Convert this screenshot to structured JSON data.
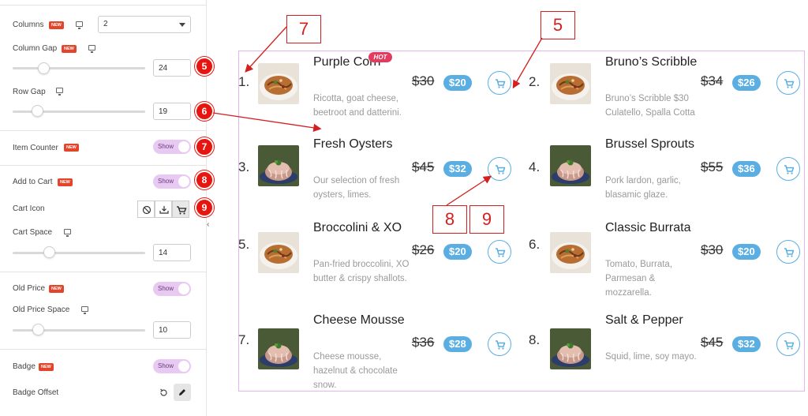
{
  "panel": {
    "new_badge": "NEW",
    "columns": {
      "label": "Columns",
      "value": "2"
    },
    "column_gap": {
      "label": "Column Gap",
      "value": "24",
      "slider_fraction": 0.24
    },
    "row_gap": {
      "label": "Row Gap",
      "value": "19",
      "slider_fraction": 0.19
    },
    "item_counter": {
      "label": "Item Counter",
      "toggle": "Show"
    },
    "add_to_cart": {
      "label": "Add to Cart",
      "toggle": "Show"
    },
    "cart_icon": {
      "label": "Cart Icon",
      "options": [
        "none-icon",
        "download-cart-icon",
        "cart-icon"
      ],
      "selected": "cart-icon"
    },
    "cart_space": {
      "label": "Cart Space",
      "value": "14",
      "slider_fraction": 0.28
    },
    "old_price": {
      "label": "Old Price",
      "toggle": "Show"
    },
    "old_price_space": {
      "label": "Old Price Space",
      "value": "10",
      "slider_fraction": 0.2
    },
    "badge": {
      "label": "Badge",
      "toggle": "Show"
    },
    "badge_offset": {
      "label": "Badge Offset"
    },
    "markers": [
      "5",
      "6",
      "7",
      "8",
      "9"
    ],
    "collapse_glyph": "‹"
  },
  "menu": {
    "hot_badge": "HOT",
    "items": [
      {
        "counter": "1.",
        "title": "Purple Corn",
        "desc": "Ricotta, goat cheese, beetroot and datterini.",
        "old": "$30",
        "price": "$20",
        "image": "pasta"
      },
      {
        "counter": "2.",
        "title": "Bruno’s Scribble",
        "desc": "Bruno’s Scribble $30 Culatello, Spalla Cotta",
        "old": "$34",
        "price": "$26",
        "image": "pasta"
      },
      {
        "counter": "3.",
        "title": "Fresh Oysters",
        "desc": "Our selection of fresh oysters, limes.",
        "old": "$45",
        "price": "$32",
        "image": "cake"
      },
      {
        "counter": "4.",
        "title": "Brussel Sprouts",
        "desc": "Pork lardon, garlic, blasamic glaze.",
        "old": "$55",
        "price": "$36",
        "image": "cake"
      },
      {
        "counter": "5.",
        "title": "Broccolini & XO",
        "desc": "Pan-fried broccolini, XO butter & crispy shallots.",
        "old": "$26",
        "price": "$20",
        "image": "pasta"
      },
      {
        "counter": "6.",
        "title": "Classic Burrata",
        "desc": "Tomato, Burrata, Parmesan & mozzarella.",
        "old": "$30",
        "price": "$20",
        "image": "pasta"
      },
      {
        "counter": "7.",
        "title": "Cheese Mousse",
        "desc": "Cheese mousse, hazelnut & chocolate snow.",
        "old": "$36",
        "price": "$28",
        "image": "cake"
      },
      {
        "counter": "8.",
        "title": "Salt & Pepper",
        "desc": "Squid, lime, soy mayo.",
        "old": "$45",
        "price": "$32",
        "image": "cake"
      }
    ]
  },
  "callouts": [
    "7",
    "5",
    "8",
    "9"
  ],
  "colors": {
    "accent": "#5aaee2",
    "toggle": "#e7c9f2",
    "marker": "#e7140f",
    "new_badge": "#e3452a",
    "hot_badge": "#e33a5f",
    "frame": "#e4b6ee"
  }
}
